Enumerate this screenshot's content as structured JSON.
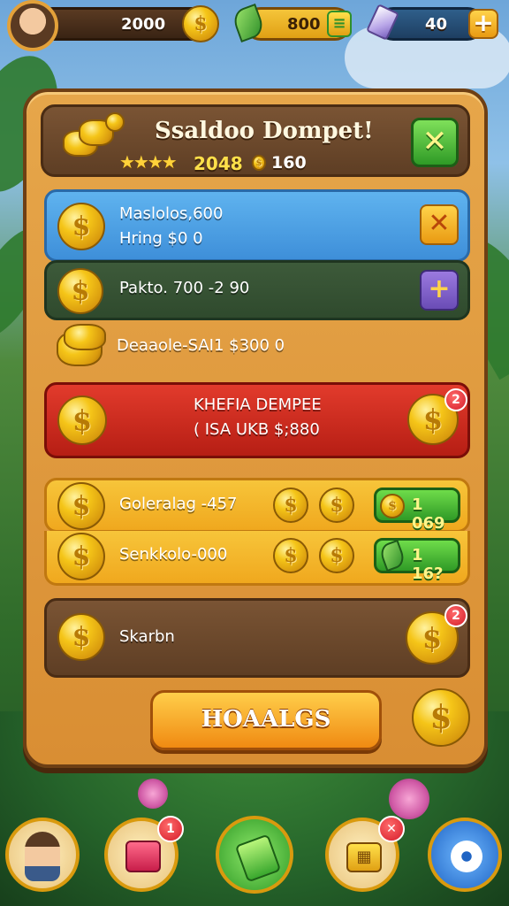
{
  "top_bar": {
    "coins": "2000",
    "leaves": "800",
    "gems": "40"
  },
  "panel": {
    "title": "Ssaldoo Dompet!",
    "rating_value": "2048",
    "rating_coins": "160"
  },
  "rows": [
    {
      "line1": "Maslolos,600",
      "line2": "Hring $0 0"
    },
    {
      "line1": "Pakto. 700 -2 90"
    },
    {
      "line1": "Deaaole-SAI1 $300 0"
    },
    {
      "line1": "KHEFIA DEMPEE",
      "line2": "( ISA UKB $;880",
      "badge": "2"
    },
    {
      "line1": "Goleralag -457",
      "pill": "1  069"
    },
    {
      "line1": "Senkkolo-000",
      "pill": "1  16?"
    },
    {
      "line1": "Skarbn",
      "badge": "2"
    }
  ],
  "primary_button": "HOAALGS",
  "bottom_nav": {
    "shop_badge": "1"
  },
  "colors": {
    "panel": "#e6a64a",
    "blue_row": "#4fa3e6",
    "red_row": "#d12e22",
    "yellow_row": "#f5b92c",
    "green_button": "#2f9a26"
  }
}
